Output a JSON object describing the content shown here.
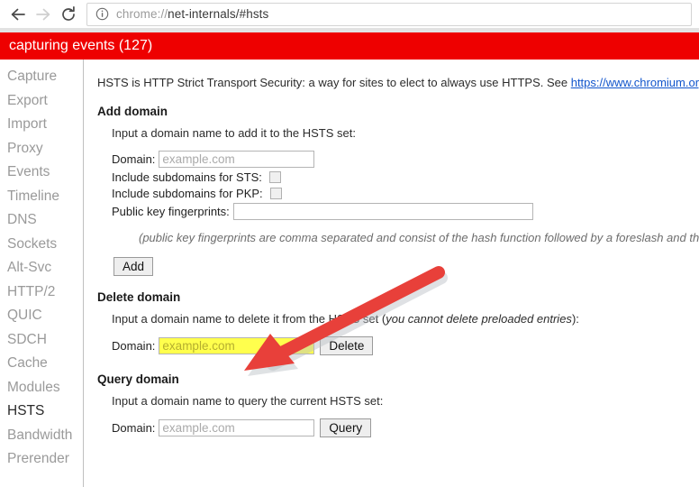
{
  "browser": {
    "back_icon": "back-arrow-icon",
    "forward_icon": "forward-arrow-icon",
    "reload_icon": "reload-icon",
    "page_info_icon": "info-circle-icon",
    "url_scheme": "chrome://",
    "url_path": "net-internals/#hsts",
    "url_full": "chrome://net-internals/#hsts"
  },
  "banner": {
    "text": "capturing events (127)",
    "color": "#ee0000",
    "text_color": "#ffffff"
  },
  "sidebar": {
    "items": [
      {
        "label": "Capture",
        "selected": false
      },
      {
        "label": "Export",
        "selected": false
      },
      {
        "label": "Import",
        "selected": false
      },
      {
        "label": "Proxy",
        "selected": false
      },
      {
        "label": "Events",
        "selected": false
      },
      {
        "label": "Timeline",
        "selected": false
      },
      {
        "label": "DNS",
        "selected": false
      },
      {
        "label": "Sockets",
        "selected": false
      },
      {
        "label": "Alt-Svc",
        "selected": false
      },
      {
        "label": "HTTP/2",
        "selected": false
      },
      {
        "label": "QUIC",
        "selected": false
      },
      {
        "label": "SDCH",
        "selected": false
      },
      {
        "label": "Cache",
        "selected": false
      },
      {
        "label": "Modules",
        "selected": false
      },
      {
        "label": "HSTS",
        "selected": true
      },
      {
        "label": "Bandwidth",
        "selected": false
      },
      {
        "label": "Prerender",
        "selected": false
      }
    ]
  },
  "main": {
    "intro_prefix": "HSTS is HTTP Strict Transport Security: a way for sites to elect to always use HTTPS. See ",
    "intro_link": "https://www.chromium.org/hsts",
    "intro_suffix": ".",
    "add_domain": {
      "heading": "Add domain",
      "description": "Input a domain name to add it to the HSTS set:",
      "domain_label": "Domain:",
      "domain_value": "",
      "domain_placeholder": "example.com",
      "sts_label": "Include subdomains for STS:",
      "sts_checked": false,
      "pkp_label": "Include subdomains for PKP:",
      "pkp_checked": false,
      "fingerprints_label": "Public key fingerprints:",
      "fingerprints_value": "",
      "note": "(public key fingerprints are comma separated and consist of the hash function followed by a foreslash and the ba",
      "add_button": "Add"
    },
    "delete_domain": {
      "heading": "Delete domain",
      "description_prefix": "Input a domain name to delete it from the HSTS set (",
      "description_em": "you cannot delete preloaded entries",
      "description_suffix": "):",
      "domain_label": "Domain:",
      "domain_value": "",
      "domain_placeholder": "example.com",
      "delete_button": "Delete",
      "highlight_color": "#ffff4d"
    },
    "query_domain": {
      "heading": "Query domain",
      "description": "Input a domain name to query the current HSTS set:",
      "domain_label": "Domain:",
      "domain_value": "",
      "domain_placeholder": "example.com",
      "query_button": "Query"
    }
  },
  "annotation": {
    "arrow_color": "#e8403a",
    "arrow_name": "red-pointer-arrow",
    "points_to": "delete-domain-input"
  }
}
